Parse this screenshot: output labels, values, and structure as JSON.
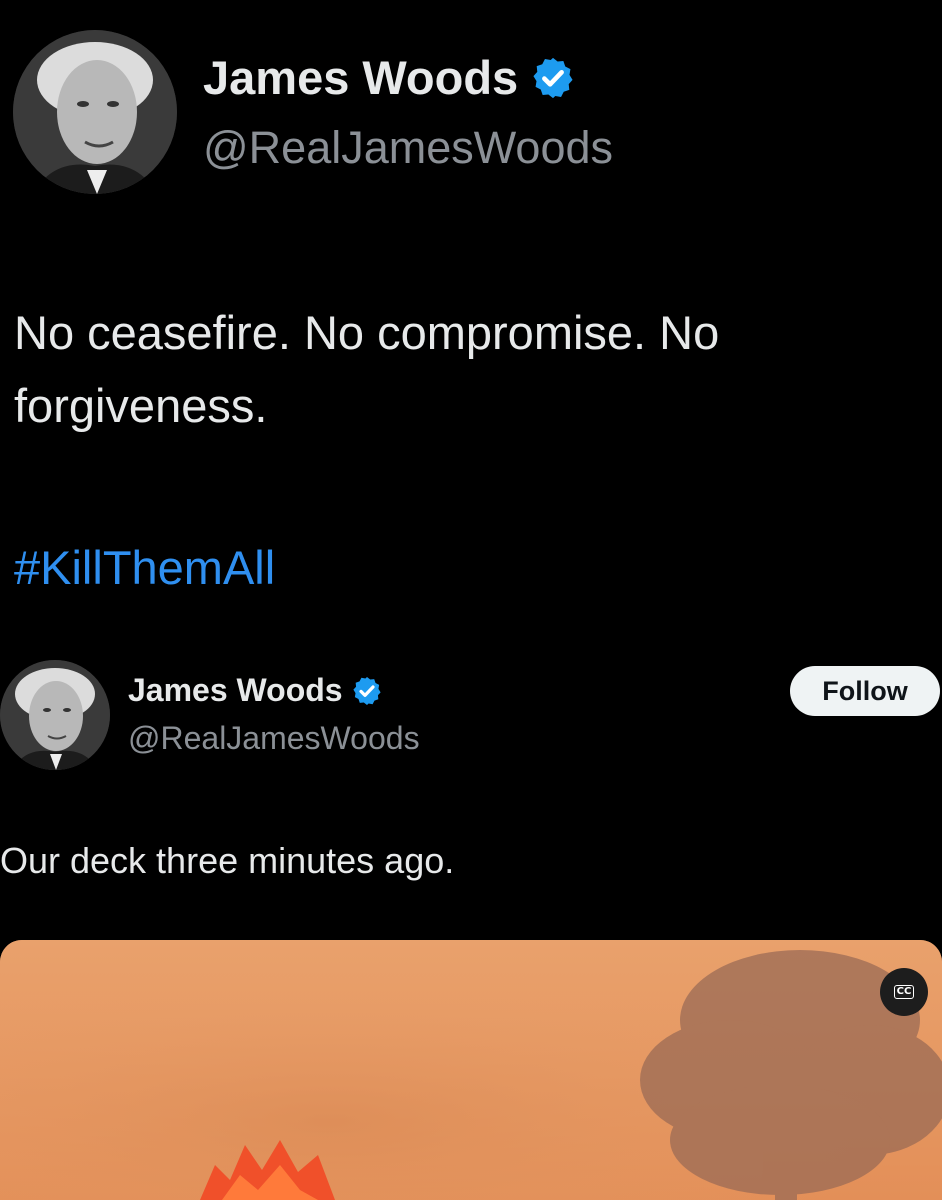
{
  "quote_post": {
    "author_name": "James Woods",
    "author_handle": "@RealJamesWoods",
    "text": "No ceasefire. No compromise. No forgiveness.",
    "hashtag": "#KillThemAll",
    "avatar_icon": "profile-photo-grayscale",
    "verified_icon": "verified-badge-icon"
  },
  "embedded_post": {
    "author_name": "James Woods",
    "author_handle": "@RealJamesWoods",
    "follow_label": "Follow",
    "text": "Our deck three minutes ago.",
    "avatar_icon": "profile-photo-grayscale",
    "verified_icon": "verified-badge-icon",
    "cc_label": "CC"
  },
  "colors": {
    "background": "#000000",
    "text_primary": "#e7e9ea",
    "text_secondary": "#8b9096",
    "hashtag_blue": "#2f8ff0",
    "verified_blue": "#1d9bf0",
    "smoke_orange": "#e39a66",
    "fire_red": "#f0502a"
  }
}
